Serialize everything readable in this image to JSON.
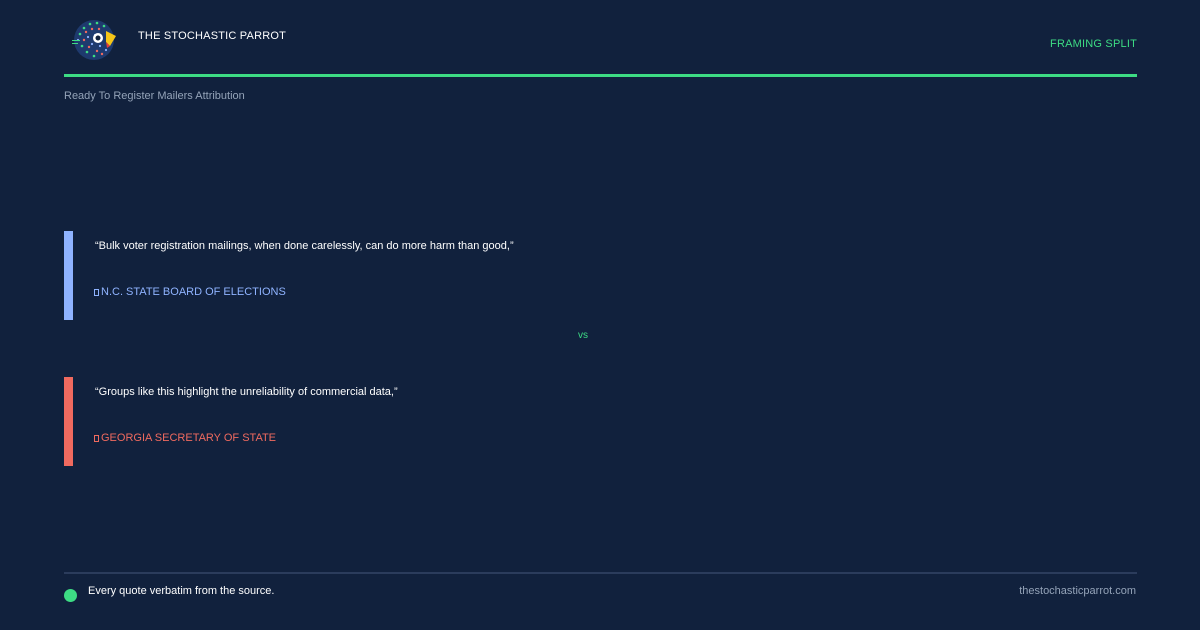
{
  "header": {
    "brand": "THE STOCHASTIC PARROT",
    "tag": "FRAMING SPLIT",
    "logo_icon": "parrot-logo-icon"
  },
  "subtitle": "Ready To Register Mailers Attribution",
  "quotes": [
    {
      "text": "“Bulk voter registration mailings, when done carelessly, can do more harm than good,”",
      "attribution": "N.C. STATE BOARD OF ELECTIONS",
      "color": "#8fb3ff"
    },
    {
      "text": "“Groups like this highlight the unreliability of commercial data,”",
      "attribution": "GEORGIA SECRETARY OF STATE",
      "color": "#f06a5f"
    }
  ],
  "vs": "vs",
  "footer": {
    "note": "Every quote verbatim from the source.",
    "site": "thestochasticparrot.com"
  },
  "colors": {
    "background": "#11213d",
    "accent": "#3ddc84"
  }
}
